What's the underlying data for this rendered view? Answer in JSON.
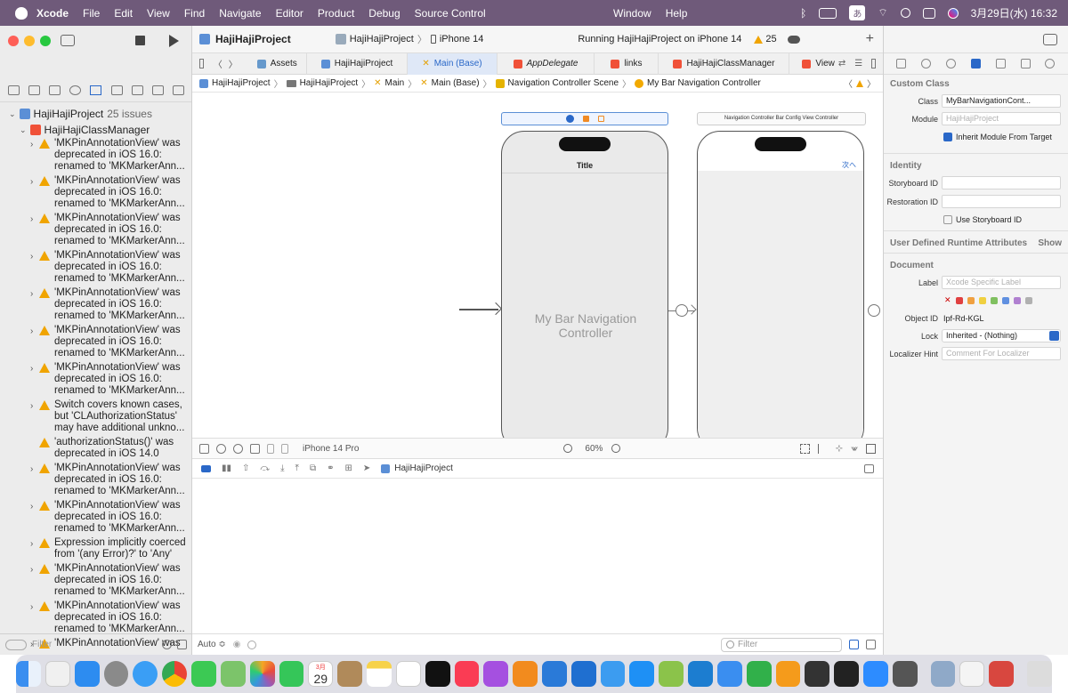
{
  "menubar": {
    "app": "Xcode",
    "items": [
      "File",
      "Edit",
      "View",
      "Find",
      "Navigate",
      "Editor",
      "Product",
      "Debug",
      "Source Control"
    ],
    "center_items": [
      "Window",
      "Help"
    ],
    "ime": "あ",
    "datetime": "3月29日(水) 16:32"
  },
  "navigator": {
    "project": "HajiHajiProject",
    "issues_count": "25 issues",
    "file": "HajiHajiClassManager",
    "issues": [
      {
        "text": "'MKPinAnnotationView' was deprecated in iOS 16.0: renamed to 'MKMarkerAnn...",
        "chevron": true
      },
      {
        "text": "'MKPinAnnotationView' was deprecated in iOS 16.0: renamed to 'MKMarkerAnn...",
        "chevron": true
      },
      {
        "text": "'MKPinAnnotationView' was deprecated in iOS 16.0: renamed to 'MKMarkerAnn...",
        "chevron": true
      },
      {
        "text": "'MKPinAnnotationView' was deprecated in iOS 16.0: renamed to 'MKMarkerAnn...",
        "chevron": true
      },
      {
        "text": "'MKPinAnnotationView' was deprecated in iOS 16.0: renamed to 'MKMarkerAnn...",
        "chevron": true
      },
      {
        "text": "'MKPinAnnotationView' was deprecated in iOS 16.0: renamed to 'MKMarkerAnn...",
        "chevron": true
      },
      {
        "text": "'MKPinAnnotationView' was deprecated in iOS 16.0: renamed to 'MKMarkerAnn...",
        "chevron": true
      },
      {
        "text": "Switch covers known cases, but 'CLAuthorizationStatus' may have additional unkno...",
        "chevron": true
      },
      {
        "text": "'authorizationStatus()' was deprecated in iOS 14.0",
        "chevron": false
      },
      {
        "text": "'MKPinAnnotationView' was deprecated in iOS 16.0: renamed to 'MKMarkerAnn...",
        "chevron": true
      },
      {
        "text": "'MKPinAnnotationView' was deprecated in iOS 16.0: renamed to 'MKMarkerAnn...",
        "chevron": true
      },
      {
        "text": "Expression implicitly coerced from '(any Error)?' to 'Any'",
        "chevron": true
      },
      {
        "text": "'MKPinAnnotationView' was deprecated in iOS 16.0: renamed to 'MKMarkerAnn...",
        "chevron": true
      },
      {
        "text": "'MKPinAnnotationView' was deprecated in iOS 16.0: renamed to 'MKMarkerAnn...",
        "chevron": true
      },
      {
        "text": "'MKPinAnnotationView' was",
        "chevron": true
      }
    ],
    "filter_placeholder": "Filter"
  },
  "toolbar": {
    "project": "HajiHajiProject",
    "scheme": "HajiHajiProject",
    "device": "iPhone 14",
    "status": "Running HajiHajiProject on iPhone 14",
    "warnings": "25"
  },
  "tabs": [
    "Assets",
    "HajiHajiProject",
    "Main (Base)",
    "AppDelegate",
    "links",
    "HajiHajiClassManager",
    "View"
  ],
  "breadcrumb": [
    "HajiHajiProject",
    "HajiHajiProject",
    "Main",
    "Main (Base)",
    "Navigation Controller Scene",
    "My Bar Navigation Controller"
  ],
  "canvas": {
    "nav_title": "Title",
    "controller_label": "My Bar Navigation Controller",
    "second_scene_title": "Navigation Controller Bar Config View Controller",
    "nav_button": "次へ"
  },
  "canvas_bar": {
    "device": "iPhone 14 Pro",
    "zoom": "60%"
  },
  "debug": {
    "process": "HajiHajiProject"
  },
  "bottom": {
    "auto": "Auto ≎",
    "filter_placeholder": "Filter"
  },
  "inspector": {
    "custom_class": {
      "heading": "Custom Class",
      "class_label": "Class",
      "class_value": "MyBarNavigationCont...",
      "module_label": "Module",
      "module_placeholder": "HajiHajiProject",
      "inherit_label": "Inherit Module From Target"
    },
    "identity": {
      "heading": "Identity",
      "storyboard_label": "Storyboard ID",
      "restoration_label": "Restoration ID",
      "use_storyboard_label": "Use Storyboard ID"
    },
    "runtime": {
      "heading": "User Defined Runtime Attributes",
      "show": "Show"
    },
    "document": {
      "heading": "Document",
      "label_label": "Label",
      "label_placeholder": "Xcode Specific Label",
      "objectid_label": "Object ID",
      "objectid_value": "Ipf-Rd-KGL",
      "lock_label": "Lock",
      "lock_value": "Inherited - (Nothing)",
      "localizer_label": "Localizer Hint",
      "localizer_placeholder": "Comment For Localizer"
    },
    "swatches": [
      "#e04040",
      "#f0a040",
      "#f0d040",
      "#80c060",
      "#6090e0",
      "#b080d0",
      "#b0b0b0"
    ]
  },
  "dock": {
    "calendar_day": "29",
    "calendar_month": "3月"
  }
}
